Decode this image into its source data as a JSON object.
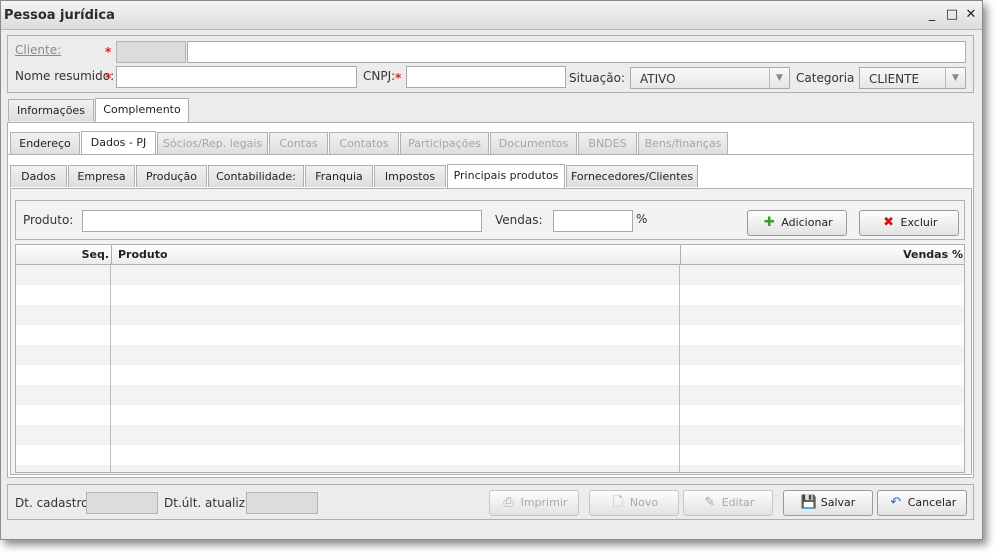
{
  "window": {
    "title": "Pessoa jurídica"
  },
  "form": {
    "cliente_label": "Cliente:",
    "nome_label": "Nome resumido:",
    "cnpj_label": "CNPJ:",
    "situacao_label": "Situação:",
    "situacao_value": "ATIVO",
    "categoria_label": "Categoria",
    "categoria_value": "CLIENTE",
    "required_mark": "*"
  },
  "tabs_level1": [
    "Informações",
    "Complemento"
  ],
  "tabs_level2": [
    "Endereço",
    "Dados - PJ",
    "Sócios/Rep. legais",
    "Contas",
    "Contatos",
    "Participações",
    "Documentos",
    "BNDES",
    "Bens/finanças"
  ],
  "tabs_level3": [
    "Dados",
    "Empresa",
    "Produção",
    "Contabilidade:",
    "Franquia",
    "Impostos",
    "Principais produtos",
    "Fornecedores/Clientes"
  ],
  "produtos": {
    "produto_label": "Produto:",
    "vendas_label": "Vendas:",
    "percent": "%",
    "adicionar": "Adicionar",
    "excluir": "Excluir"
  },
  "grid": {
    "columns": [
      "Seq.",
      "Produto",
      "Vendas %"
    ],
    "rows": []
  },
  "footer": {
    "dt_cadastro_label": "Dt. cadastro:",
    "dt_ult_label": "Dt.últ. atualiz.:",
    "imprimir": "Imprimir",
    "novo": "Novo",
    "editar": "Editar",
    "salvar": "Salvar",
    "cancelar": "Cancelar"
  },
  "colors": {
    "required": "#dd2222",
    "excluir_icon": "#d01515",
    "adicionar_icon": "#3a9a2a",
    "cancelar_icon": "#2a6fbd"
  }
}
